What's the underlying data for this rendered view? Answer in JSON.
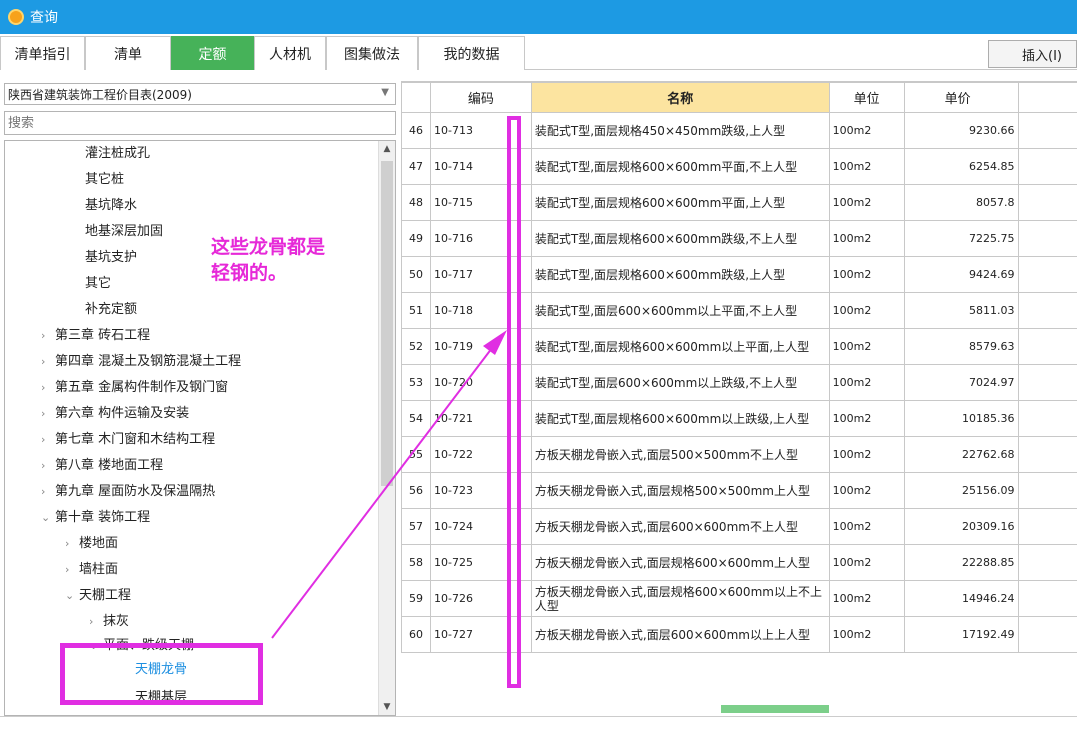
{
  "window": {
    "title": "查询"
  },
  "tabs": [
    {
      "label": "清单指引"
    },
    {
      "label": "清单"
    },
    {
      "label": "定额"
    },
    {
      "label": "人材机"
    },
    {
      "label": "图集做法"
    },
    {
      "label": "我的数据"
    }
  ],
  "toolbar": {
    "insert_label": "插入(I)"
  },
  "library": {
    "selected": "陕西省建筑装饰工程价目表(2009)"
  },
  "search": {
    "placeholder": "搜索"
  },
  "tree": [
    {
      "label": "灌注桩成孔",
      "arrow": ""
    },
    {
      "label": "其它桩",
      "arrow": ""
    },
    {
      "label": "基坑降水",
      "arrow": ""
    },
    {
      "label": "地基深层加固",
      "arrow": ""
    },
    {
      "label": "基坑支护",
      "arrow": ""
    },
    {
      "label": "其它",
      "arrow": ""
    },
    {
      "label": "补充定额",
      "arrow": ""
    },
    {
      "label": "第三章 砖石工程",
      "arrow": "›"
    },
    {
      "label": "第四章 混凝土及钢筋混凝土工程",
      "arrow": "›"
    },
    {
      "label": "第五章 金属构件制作及钢门窗",
      "arrow": "›"
    },
    {
      "label": "第六章 构件运输及安装",
      "arrow": "›"
    },
    {
      "label": "第七章 木门窗和木结构工程",
      "arrow": "›"
    },
    {
      "label": "第八章 楼地面工程",
      "arrow": "›"
    },
    {
      "label": "第九章 屋面防水及保温隔热",
      "arrow": "›"
    },
    {
      "label": "第十章 装饰工程",
      "arrow": "⌄"
    },
    {
      "label": "楼地面",
      "arrow": "›"
    },
    {
      "label": "墙柱面",
      "arrow": "›"
    },
    {
      "label": "天棚工程",
      "arrow": "⌄"
    },
    {
      "label": "抹灰",
      "arrow": "›"
    },
    {
      "label": "平面、跌级天棚",
      "arrow": "⌄"
    },
    {
      "label": "天棚龙骨",
      "arrow": ""
    },
    {
      "label": "天棚基层",
      "arrow": ""
    }
  ],
  "annotation": {
    "line1": "这些龙骨都是",
    "line2": "轻钢的。"
  },
  "grid": {
    "headers": {
      "num": "",
      "code": "编码",
      "name": "名称",
      "unit": "单位",
      "price": "单价"
    },
    "rows": [
      {
        "n": "46",
        "code": "10-713",
        "name": "装配式T型,面层规格450×450mm跌级,上人型",
        "unit": "100m2",
        "price": "9230.66"
      },
      {
        "n": "47",
        "code": "10-714",
        "name": "装配式T型,面层规格600×600mm平面,不上人型",
        "unit": "100m2",
        "price": "6254.85"
      },
      {
        "n": "48",
        "code": "10-715",
        "name": "装配式T型,面层规格600×600mm平面,上人型",
        "unit": "100m2",
        "price": "8057.8"
      },
      {
        "n": "49",
        "code": "10-716",
        "name": "装配式T型,面层规格600×600mm跌级,不上人型",
        "unit": "100m2",
        "price": "7225.75"
      },
      {
        "n": "50",
        "code": "10-717",
        "name": "装配式T型,面层规格600×600mm跌级,上人型",
        "unit": "100m2",
        "price": "9424.69"
      },
      {
        "n": "51",
        "code": "10-718",
        "name": "装配式T型,面层600×600mm以上平面,不上人型",
        "unit": "100m2",
        "price": "5811.03"
      },
      {
        "n": "52",
        "code": "10-719",
        "name": "装配式T型,面层规格600×600mm以上平面,上人型",
        "unit": "100m2",
        "price": "8579.63"
      },
      {
        "n": "53",
        "code": "10-720",
        "name": "装配式T型,面层600×600mm以上跌级,不上人型",
        "unit": "100m2",
        "price": "7024.97"
      },
      {
        "n": "54",
        "code": "10-721",
        "name": "装配式T型,面层规格600×600mm以上跌级,上人型",
        "unit": "100m2",
        "price": "10185.36"
      },
      {
        "n": "55",
        "code": "10-722",
        "name": "方板天棚龙骨嵌入式,面层500×500mm不上人型",
        "unit": "100m2",
        "price": "22762.68"
      },
      {
        "n": "56",
        "code": "10-723",
        "name": "方板天棚龙骨嵌入式,面层规格500×500mm上人型",
        "unit": "100m2",
        "price": "25156.09"
      },
      {
        "n": "57",
        "code": "10-724",
        "name": "方板天棚龙骨嵌入式,面层600×600mm不上人型",
        "unit": "100m2",
        "price": "20309.16"
      },
      {
        "n": "58",
        "code": "10-725",
        "name": "方板天棚龙骨嵌入式,面层规格600×600mm上人型",
        "unit": "100m2",
        "price": "22288.85"
      },
      {
        "n": "59",
        "code": "10-726",
        "name": "方板天棚龙骨嵌入式,面层规格600×600mm以上不上人型",
        "unit": "100m2",
        "price": "14946.24"
      },
      {
        "n": "60",
        "code": "10-727",
        "name": "方板天棚龙骨嵌入式,面层600×600mm以上上人型",
        "unit": "100m2",
        "price": "17192.49"
      }
    ]
  },
  "colors": {
    "titlebar": "#1d9ae3",
    "active_tab": "#46b259",
    "annotation": "#e629d8",
    "header_highlight": "#fce4a0"
  }
}
